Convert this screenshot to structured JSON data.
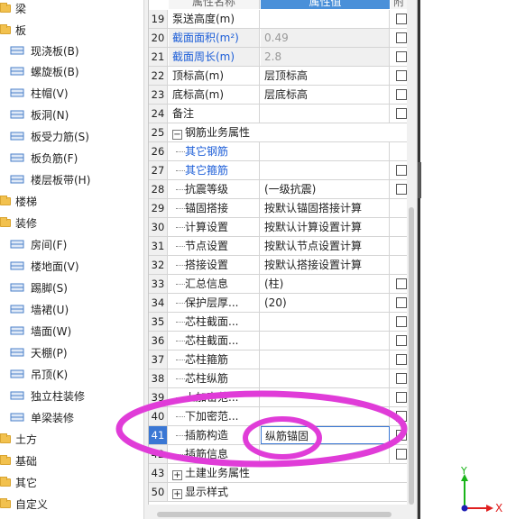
{
  "tree": {
    "items": [
      {
        "label": "梁",
        "kind": "folder"
      },
      {
        "label": "板",
        "kind": "folder"
      },
      {
        "label": "现浇板(B)",
        "kind": "child",
        "icon": "slab-icon"
      },
      {
        "label": "螺旋板(B)",
        "kind": "child",
        "icon": "spiral-slab-icon"
      },
      {
        "label": "柱帽(V)",
        "kind": "child",
        "icon": "column-cap-icon"
      },
      {
        "label": "板洞(N)",
        "kind": "child",
        "icon": "slab-hole-icon"
      },
      {
        "label": "板受力筋(S)",
        "kind": "child",
        "icon": "slab-rebar-icon"
      },
      {
        "label": "板负筋(F)",
        "kind": "child",
        "icon": "negative-rebar-icon"
      },
      {
        "label": "楼层板带(H)",
        "kind": "child",
        "icon": "slab-strip-icon"
      },
      {
        "label": "楼梯",
        "kind": "folder"
      },
      {
        "label": "装修",
        "kind": "folder"
      },
      {
        "label": "房间(F)",
        "kind": "child",
        "icon": "room-icon"
      },
      {
        "label": "楼地面(V)",
        "kind": "child",
        "icon": "floor-icon"
      },
      {
        "label": "踢脚(S)",
        "kind": "child",
        "icon": "skirting-icon"
      },
      {
        "label": "墙裙(U)",
        "kind": "child",
        "icon": "dado-icon"
      },
      {
        "label": "墙面(W)",
        "kind": "child",
        "icon": "wall-face-icon"
      },
      {
        "label": "天棚(P)",
        "kind": "child",
        "icon": "ceiling-icon"
      },
      {
        "label": "吊顶(K)",
        "kind": "child",
        "icon": "suspended-ceiling-icon"
      },
      {
        "label": "独立柱装修",
        "kind": "child",
        "icon": "column-finish-icon"
      },
      {
        "label": "单梁装修",
        "kind": "child",
        "icon": "beam-finish-icon"
      },
      {
        "label": "土方",
        "kind": "folder"
      },
      {
        "label": "基础",
        "kind": "folder"
      },
      {
        "label": "其它",
        "kind": "folder"
      },
      {
        "label": "自定义",
        "kind": "folder"
      }
    ]
  },
  "grid": {
    "header": {
      "name": "属性名称",
      "value": "属性值",
      "attach": "附"
    },
    "rows": [
      {
        "num": "19",
        "name": "泵送高度(m)",
        "value": "",
        "check": true
      },
      {
        "num": "20",
        "name": "截面面积(m²)",
        "value": "0.49",
        "check": true,
        "gray": true,
        "blue": true
      },
      {
        "num": "21",
        "name": "截面周长(m)",
        "value": "2.8",
        "check": true,
        "gray": true,
        "blue": true
      },
      {
        "num": "22",
        "name": "顶标高(m)",
        "value": "层顶标高",
        "check": true
      },
      {
        "num": "23",
        "name": "底标高(m)",
        "value": "层底标高",
        "check": true
      },
      {
        "num": "24",
        "name": "备注",
        "value": "",
        "check": true
      },
      {
        "num": "25",
        "name": "钢筋业务属性",
        "value": "",
        "group": true,
        "expander": "−"
      },
      {
        "num": "26",
        "name": "其它钢筋",
        "value": "",
        "check": false,
        "sub": true,
        "blue": true
      },
      {
        "num": "27",
        "name": "其它箍筋",
        "value": "",
        "check": true,
        "sub": true,
        "blue": true
      },
      {
        "num": "28",
        "name": "抗震等级",
        "value": "(一级抗震)",
        "check": true,
        "sub": true
      },
      {
        "num": "29",
        "name": "锚固搭接",
        "value": "按默认锚固搭接计算",
        "check": false,
        "sub": true
      },
      {
        "num": "30",
        "name": "计算设置",
        "value": "按默认计算设置计算",
        "check": false,
        "sub": true
      },
      {
        "num": "31",
        "name": "节点设置",
        "value": "按默认节点设置计算",
        "check": false,
        "sub": true
      },
      {
        "num": "32",
        "name": "搭接设置",
        "value": "按默认搭接设置计算",
        "check": false,
        "sub": true
      },
      {
        "num": "33",
        "name": "汇总信息",
        "value": "(柱)",
        "check": true,
        "sub": true
      },
      {
        "num": "34",
        "name": "保护层厚...",
        "value": "(20)",
        "check": true,
        "sub": true
      },
      {
        "num": "35",
        "name": "芯柱截面...",
        "value": "",
        "check": true,
        "sub": true
      },
      {
        "num": "36",
        "name": "芯柱截面...",
        "value": "",
        "check": true,
        "sub": true
      },
      {
        "num": "37",
        "name": "芯柱箍筋",
        "value": "",
        "check": true,
        "sub": true
      },
      {
        "num": "38",
        "name": "芯柱纵筋",
        "value": "",
        "check": true,
        "sub": true
      },
      {
        "num": "39",
        "name": "上加密范...",
        "value": "",
        "check": true,
        "sub": true
      },
      {
        "num": "40",
        "name": "下加密范...",
        "value": "",
        "check": true,
        "sub": true
      },
      {
        "num": "41",
        "name": "插筋构造",
        "value": "纵筋锚固",
        "check": true,
        "sub": true,
        "selected": true
      },
      {
        "num": "42",
        "name": "插筋信息",
        "value": "",
        "check": true,
        "sub": true
      },
      {
        "num": "43",
        "name": "土建业务属性",
        "value": "",
        "group": true,
        "expander": "+"
      },
      {
        "num": "50",
        "name": "显示样式",
        "value": "",
        "group": true,
        "expander": "+"
      }
    ]
  },
  "viewport": {
    "axis_y": "Y",
    "axis_x": "X"
  },
  "colors": {
    "annotation": "#e03cd8",
    "selection": "#3a77d4",
    "link_text": "#1e5fd8"
  }
}
